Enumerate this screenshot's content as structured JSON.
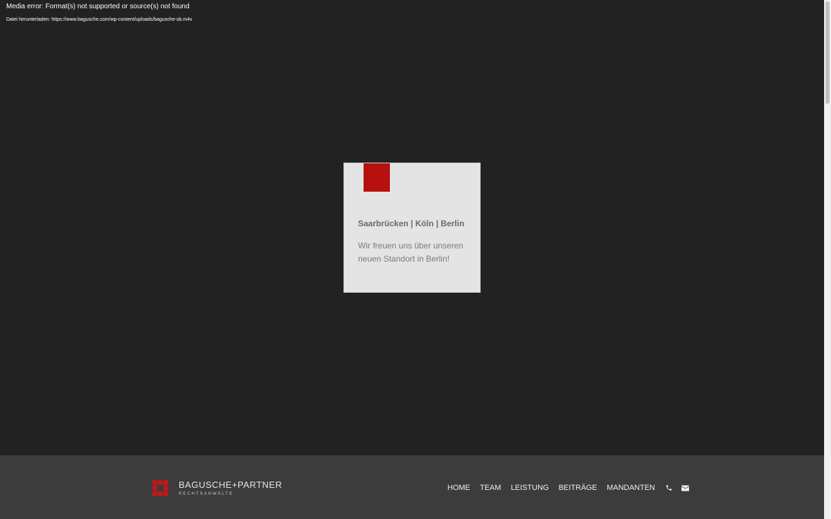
{
  "media": {
    "error": "Media error: Format(s) not supported or source(s) not found",
    "download": "Datei herunterladen: https://www.bagusche.com/wp-content/uploads/bagusche-sb.m4v"
  },
  "card": {
    "title": "Saarbrücken | Köln | Berlin",
    "text": "Wir freuen uns über unseren neuen Standort in Berlin!"
  },
  "footer": {
    "logo_name": "BAGUSCHE+PARTNER",
    "logo_sub": "RECHTSANWÄLTE",
    "nav": [
      "HOME",
      "TEAM",
      "LEISTUNG",
      "BEITRÄGE",
      "MANDANTEN"
    ],
    "icons": [
      "phone-icon",
      "email-icon"
    ]
  },
  "colors": {
    "background": "#222222",
    "footer": "#3c3c3c",
    "accent": "#b80f0f"
  }
}
